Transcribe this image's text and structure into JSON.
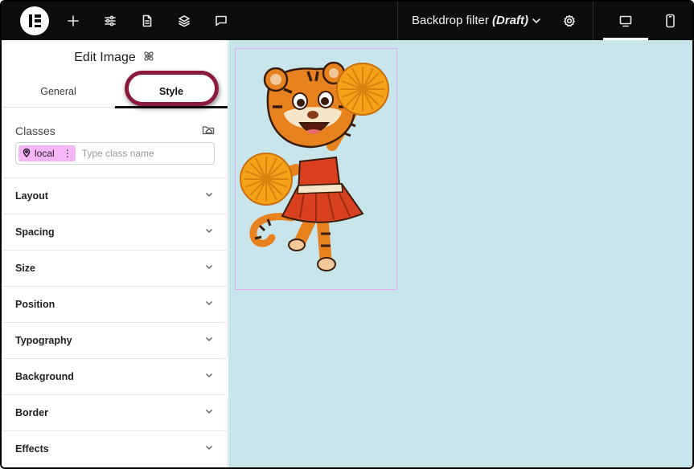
{
  "topbar": {
    "logo": "elementor-logo",
    "tools": [
      "add-icon",
      "sliders-icon",
      "page-icon",
      "layers-icon",
      "comment-icon"
    ],
    "document_title": "Backdrop filter",
    "document_status": "(Draft)",
    "icons": {
      "dropdown": "chevron-down-icon",
      "settings": "gear-icon",
      "desktop": "desktop-icon",
      "mobile": "mobile-icon"
    }
  },
  "panel": {
    "title": "Edit Image",
    "title_icon": "atom-icon",
    "tabs": [
      {
        "label": "General",
        "active": false
      },
      {
        "label": "Style",
        "active": true
      }
    ],
    "classes": {
      "label": "Classes",
      "chip_label": "local",
      "chip_menu": "⋮",
      "placeholder": "Type class name"
    },
    "sections": [
      {
        "label": "Layout"
      },
      {
        "label": "Spacing"
      },
      {
        "label": "Size"
      },
      {
        "label": "Position"
      },
      {
        "label": "Typography"
      },
      {
        "label": "Background"
      },
      {
        "label": "Border"
      },
      {
        "label": "Effects"
      }
    ]
  },
  "canvas": {
    "background": "#c9e5ec",
    "image": "tiger-cheerleader-illustration"
  },
  "colors": {
    "topbar": "#0c0d0e",
    "highlight": "#8c1a3d",
    "chip": "#f4b6f7",
    "selection_outline": "#e7a8f0"
  }
}
